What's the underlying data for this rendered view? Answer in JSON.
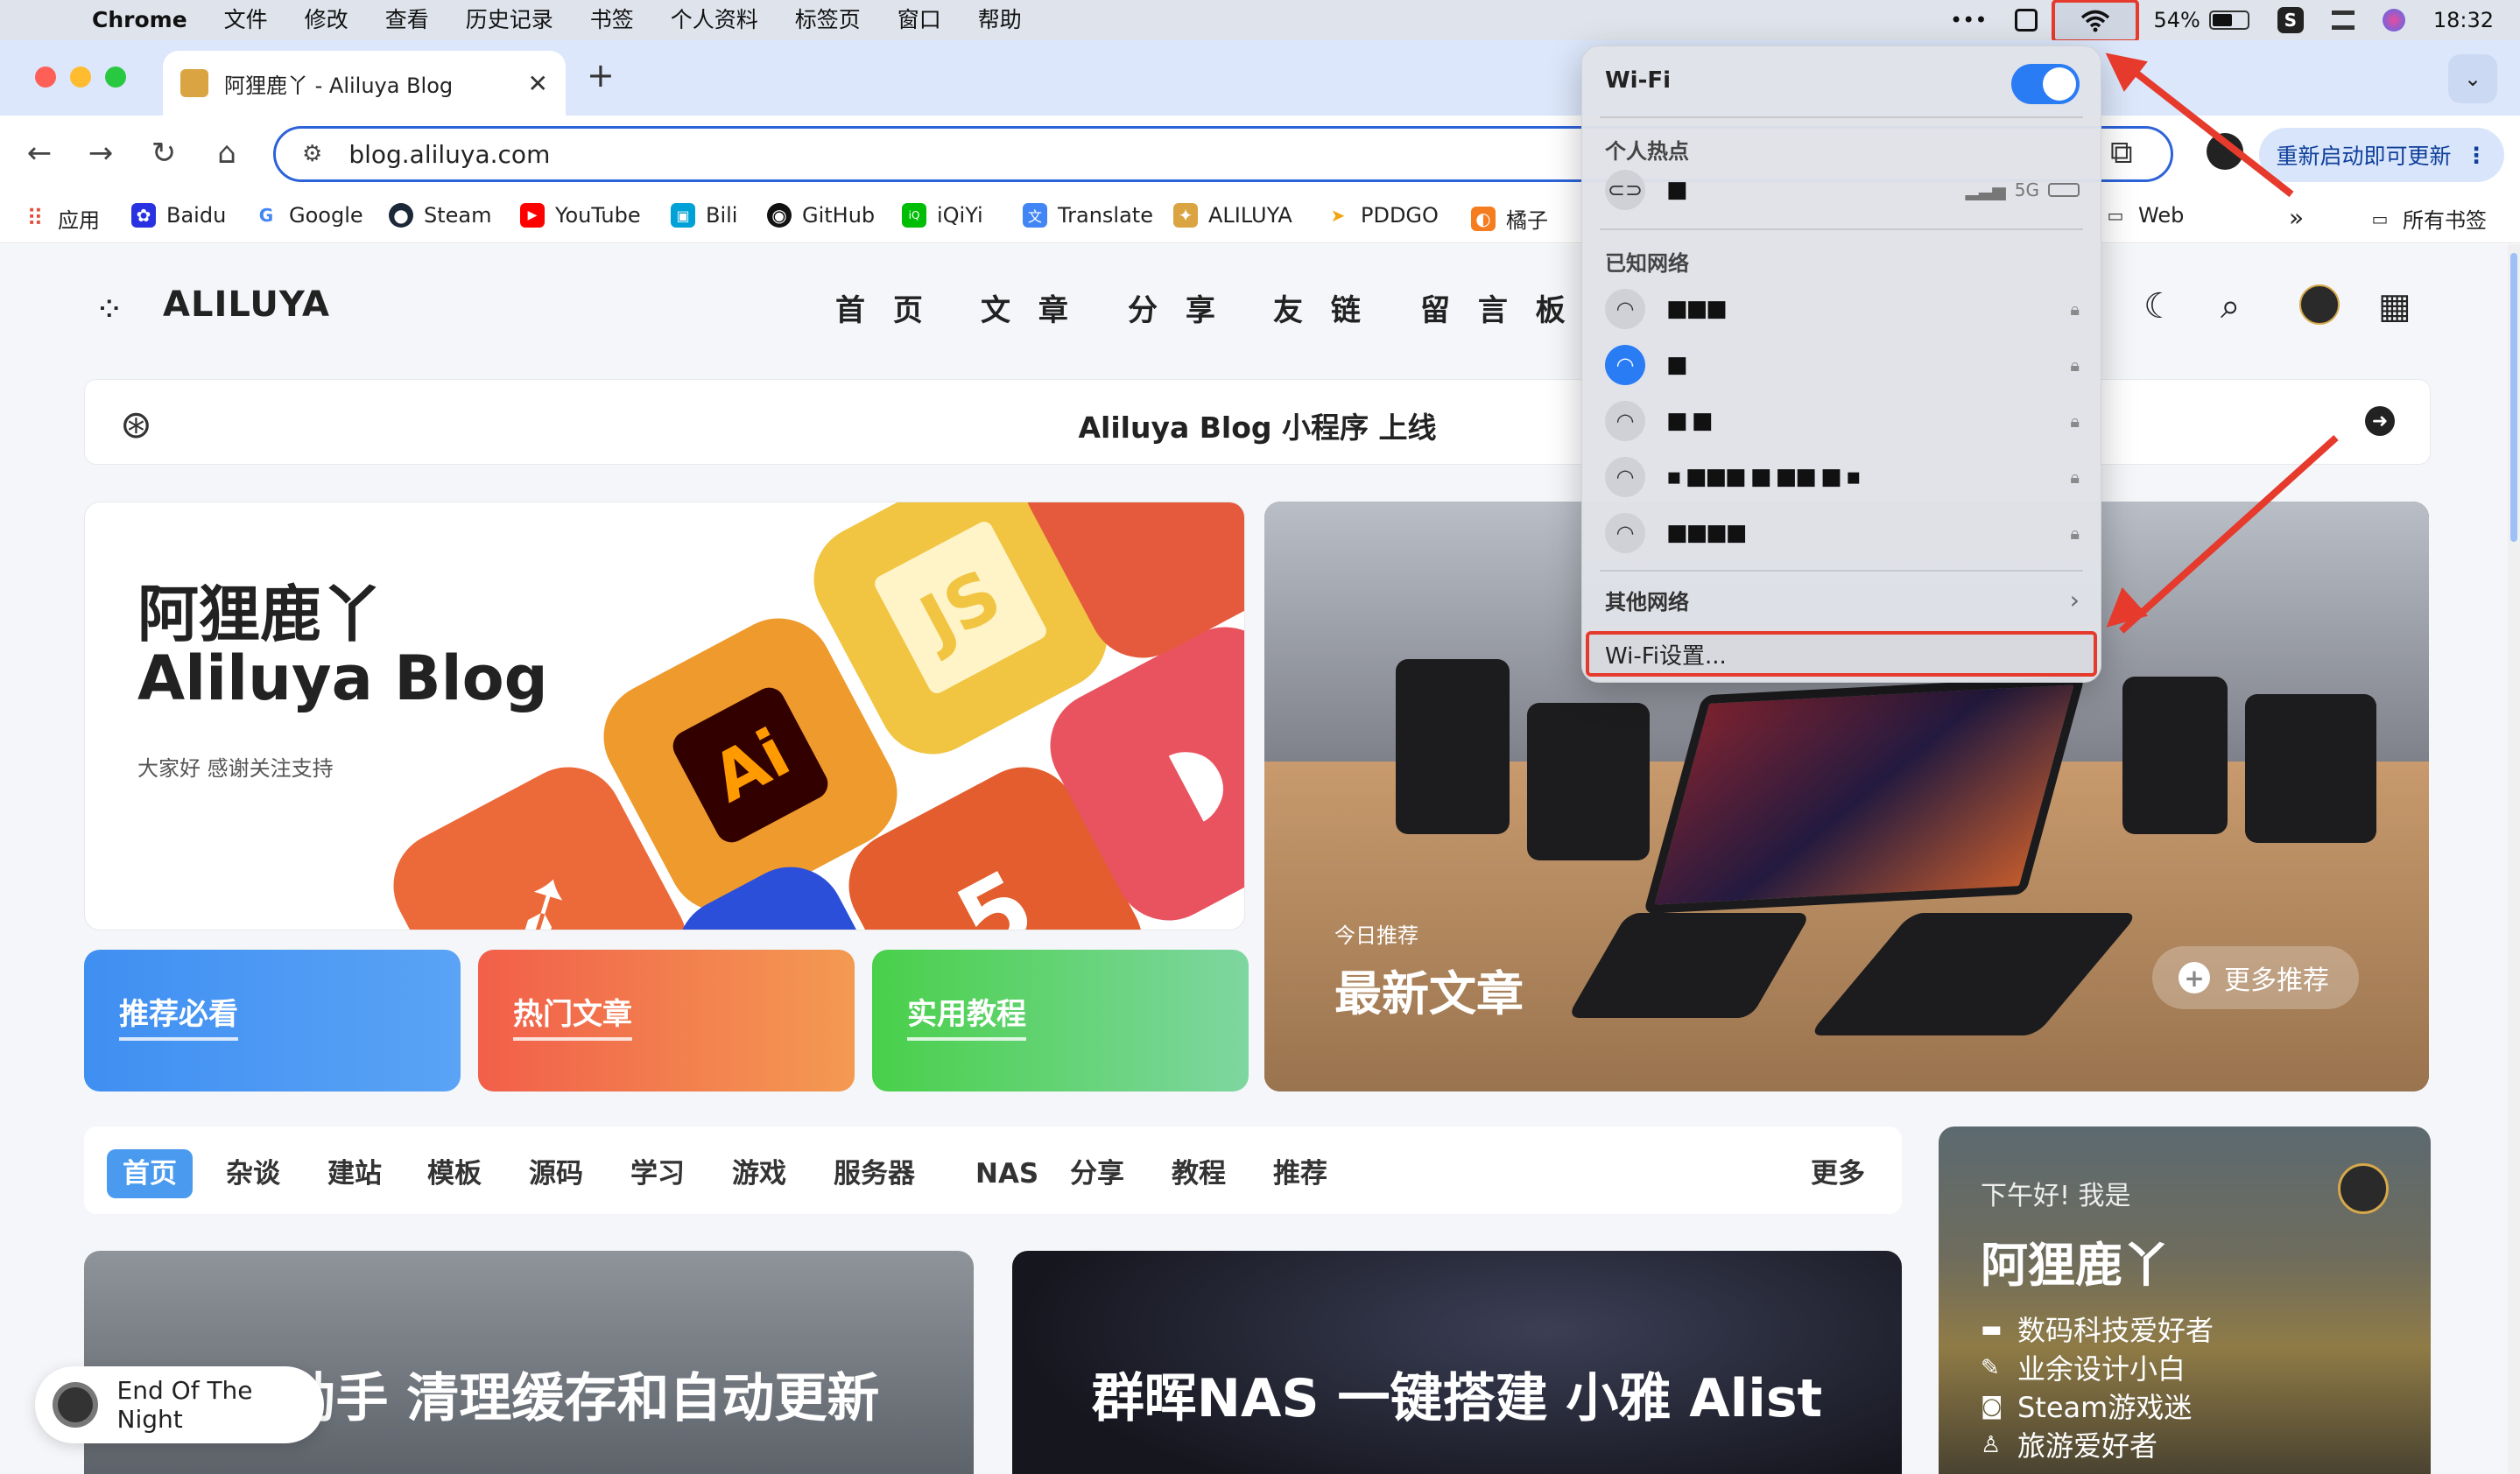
{
  "menubar": {
    "app": "Chrome",
    "items": [
      "文件",
      "修改",
      "查看",
      "历史记录",
      "书签",
      "个人资料",
      "标签页",
      "窗口",
      "帮助"
    ],
    "battery": "54%",
    "time": "18:32"
  },
  "browser": {
    "tab_title": "阿狸鹿丫 - Aliluya Blog",
    "url": "blog.aliluya.com",
    "update_label": "重新启动即可更新"
  },
  "bookmarks": {
    "items": [
      {
        "label": "应用",
        "icon": "apps-grid-icon"
      },
      {
        "label": "Baidu",
        "icon": "baidu-icon"
      },
      {
        "label": "Google",
        "icon": "google-icon"
      },
      {
        "label": "Steam",
        "icon": "steam-icon"
      },
      {
        "label": "YouTube",
        "icon": "youtube-icon"
      },
      {
        "label": "Bili",
        "icon": "bilibili-icon"
      },
      {
        "label": "GitHub",
        "icon": "github-icon"
      },
      {
        "label": "iQiYi",
        "icon": "iqiyi-icon"
      },
      {
        "label": "Translate",
        "icon": "translate-icon"
      },
      {
        "label": "ALILUYA",
        "icon": "aliluya-icon"
      },
      {
        "label": "PDDGO",
        "icon": "pddgo-icon"
      },
      {
        "label": "橘子",
        "icon": "orange-icon"
      }
    ],
    "web": "Web",
    "all": "所有书签"
  },
  "site": {
    "logo": "ALILUYA",
    "nav": [
      "首 页",
      "文 章",
      "分 享",
      "友 链",
      "留 言 板"
    ],
    "notice": "Aliluya Blog 小程序 上线",
    "hero": {
      "title_cn": "阿狸鹿丫",
      "title_en": "Aliluya Blog",
      "subtitle": "大家好 感谢关注支持",
      "tiles": [
        "Ai",
        "JS",
        "5"
      ]
    },
    "categories": [
      {
        "label": "推荐必看",
        "color": "#3f8ff2"
      },
      {
        "label": "热门文章",
        "color": "#f26a4b"
      },
      {
        "label": "实用教程",
        "color": "#58cf5a"
      }
    ],
    "featured": {
      "kicker": "今日推荐",
      "title": "最新文章",
      "more": "更多推荐"
    },
    "tags": [
      "首页",
      "杂谈",
      "建站",
      "模板",
      "源码",
      "学习",
      "游戏",
      "服务器",
      "NAS",
      "分享",
      "教程",
      "推荐"
    ],
    "tags_more": "更多",
    "profile": {
      "greeting": "下午好! 我是",
      "name": "阿狸鹿丫",
      "traits": [
        "数码科技爱好者",
        "业余设计小白",
        "Steam游戏迷",
        "旅游爱好者"
      ]
    },
    "posts": [
      {
        "title": "小雅助手 清理缓存和自动更新"
      },
      {
        "title": "群晖NAS 一键搭建 小雅 Alist"
      }
    ],
    "player": "End Of The Night"
  },
  "wifi_menu": {
    "title": "Wi-Fi",
    "hotspot_section": "个人热点",
    "hotspot_band": "5G",
    "known_section": "已知网络",
    "networks": [
      {
        "name": "■■■",
        "connected": false
      },
      {
        "name": "■",
        "connected": true
      },
      {
        "name": "■ ■",
        "connected": false
      },
      {
        "name": "▪ ■■■ ■ ■■ ■ ▪",
        "connected": false
      },
      {
        "name": "■■■■",
        "connected": false
      }
    ],
    "other": "其他网络",
    "settings": "Wi-Fi设置..."
  }
}
